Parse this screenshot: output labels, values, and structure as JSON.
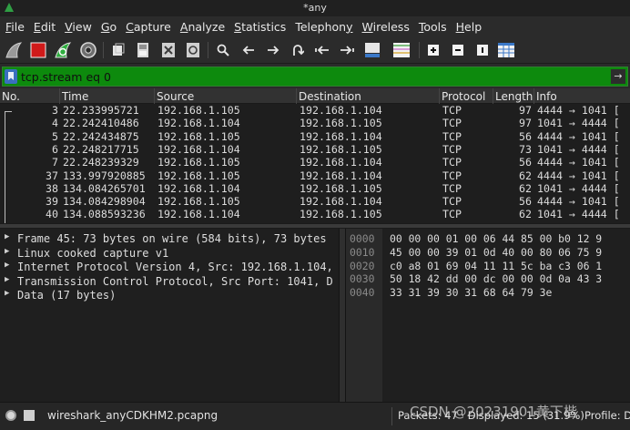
{
  "window": {
    "title": "*any"
  },
  "menu": [
    "File",
    "Edit",
    "View",
    "Go",
    "Capture",
    "Analyze",
    "Statistics",
    "Telephony",
    "Wireless",
    "Tools",
    "Help"
  ],
  "menu_mnemonic": [
    "F",
    "E",
    "V",
    "G",
    "C",
    "A",
    "S",
    "y",
    "W",
    "T",
    "H"
  ],
  "toolbar": {
    "icons": [
      "shark-fin-start-icon",
      "stop-square-icon",
      "restart-fin-icon",
      "gear-options-icon",
      "open-file-icon",
      "save-file-icon",
      "close-file-icon",
      "reload-file-icon",
      "search-icon",
      "go-back-icon",
      "go-forward-icon",
      "go-to-packet-icon",
      "go-first-icon",
      "go-last-icon",
      "autoscroll-icon",
      "colorize-icon",
      "zoom-in-icon",
      "zoom-out-icon",
      "normal-size-icon",
      "resize-columns-icon"
    ]
  },
  "filter": {
    "value": "tcp.stream eq 0"
  },
  "packet_list": {
    "columns": [
      "No.",
      "Time",
      "Source",
      "Destination",
      "Protocol",
      "Length",
      "Info"
    ],
    "rows": [
      {
        "no": "3",
        "time": "22.233995721",
        "source": "192.168.1.105",
        "destination": "192.168.1.104",
        "protocol": "TCP",
        "length": "97",
        "info": "4444 → 1041 ["
      },
      {
        "no": "4",
        "time": "22.242410486",
        "source": "192.168.1.104",
        "destination": "192.168.1.105",
        "protocol": "TCP",
        "length": "97",
        "info": "1041 → 4444 ["
      },
      {
        "no": "5",
        "time": "22.242434875",
        "source": "192.168.1.105",
        "destination": "192.168.1.104",
        "protocol": "TCP",
        "length": "56",
        "info": "4444 → 1041 ["
      },
      {
        "no": "6",
        "time": "22.248217715",
        "source": "192.168.1.104",
        "destination": "192.168.1.105",
        "protocol": "TCP",
        "length": "73",
        "info": "1041 → 4444 ["
      },
      {
        "no": "7",
        "time": "22.248239329",
        "source": "192.168.1.105",
        "destination": "192.168.1.104",
        "protocol": "TCP",
        "length": "56",
        "info": "4444 → 1041 ["
      },
      {
        "no": "37",
        "time": "133.997920885",
        "source": "192.168.1.105",
        "destination": "192.168.1.104",
        "protocol": "TCP",
        "length": "62",
        "info": "4444 → 1041 ["
      },
      {
        "no": "38",
        "time": "134.084265701",
        "source": "192.168.1.104",
        "destination": "192.168.1.105",
        "protocol": "TCP",
        "length": "62",
        "info": "1041 → 4444 ["
      },
      {
        "no": "39",
        "time": "134.084298904",
        "source": "192.168.1.105",
        "destination": "192.168.1.104",
        "protocol": "TCP",
        "length": "56",
        "info": "4444 → 1041 ["
      },
      {
        "no": "40",
        "time": "134.088593236",
        "source": "192.168.1.104",
        "destination": "192.168.1.105",
        "protocol": "TCP",
        "length": "62",
        "info": "1041 → 4444 ["
      }
    ]
  },
  "details": [
    "Frame 45: 73 bytes on wire (584 bits), 73 bytes",
    "Linux cooked capture v1",
    "Internet Protocol Version 4, Src: 192.168.1.104,",
    "Transmission Control Protocol, Src Port: 1041, D",
    "Data (17 bytes)"
  ],
  "hex_dump": [
    {
      "offset": "0000",
      "bytes": "00 00 00 01 00 06 44 85  00 b0 12 9"
    },
    {
      "offset": "0010",
      "bytes": "45 00 00 39 01 0d 40 00  80 06 75 9"
    },
    {
      "offset": "0020",
      "bytes": "c0 a8 01 69 04 11 11 5c  ba c3 06 1"
    },
    {
      "offset": "0030",
      "bytes": "50 18 42 dd 00 dc 00 00  0d 0a 43 3"
    },
    {
      "offset": "0040",
      "bytes": "33 31 39 30 31 68 64 79  3e"
    }
  ],
  "status": {
    "file": "wireshark_anyCDKHM2.pcapng",
    "counts": "Packets: 47 · Displayed: 15 (31.9%)",
    "profile": "Profile: D"
  },
  "watermark": "CSDN @20231901黄下楷",
  "colors": {
    "filter_ok": "#0d8a0d",
    "record_stop": "#d01a1a",
    "restart": "#2fae3f"
  }
}
